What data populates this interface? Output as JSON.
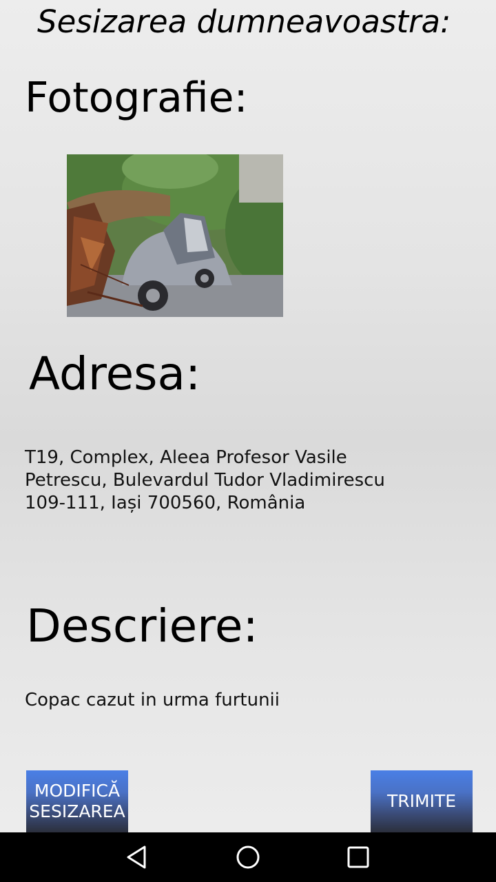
{
  "header": {
    "title": "Sesizarea dumneavoastra:"
  },
  "photo_section": {
    "label": "Fotografie:"
  },
  "address_section": {
    "label": "Adresa:",
    "lines": [
      "T19, Complex, Aleea Profesor Vasile",
      "Petrescu, Bulevardul Tudor Vladimirescu",
      "109-111, Iași 700560, România"
    ]
  },
  "description_section": {
    "label": "Descriere:",
    "value": "Copac cazut in urma furtunii"
  },
  "buttons": {
    "modify_line1": "MODIFICĂ",
    "modify_line2": "SESIZAREA",
    "send": "TRIMITE"
  },
  "colors": {
    "button_top": "#4a7fe6",
    "button_bottom": "#2b2f3c",
    "navbar": "#000000"
  },
  "navbar": {
    "icons": [
      "back-icon",
      "home-icon",
      "recent-apps-icon"
    ]
  }
}
